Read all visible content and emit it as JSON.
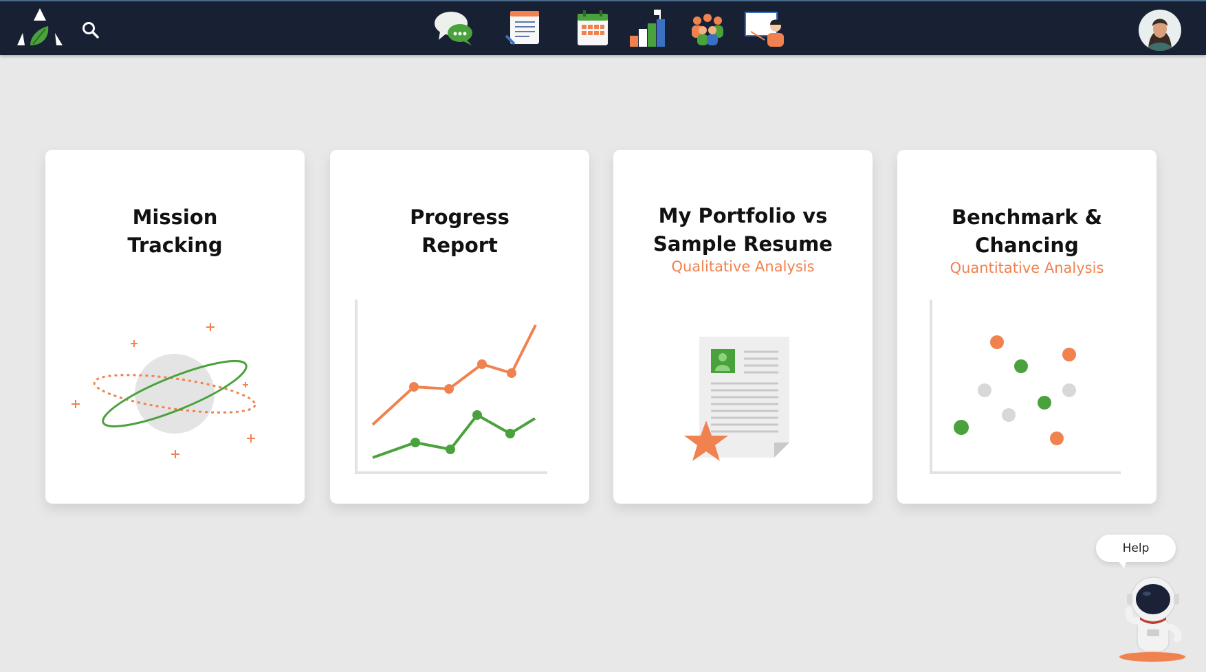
{
  "header": {
    "logo_icon": "leaf-triangle-logo-icon",
    "search_icon": "search-icon",
    "nav_icons": [
      "chat-bubbles-icon",
      "notepad-icon",
      "calendar-icon",
      "progress-flag-icon",
      "group-icon",
      "presentation-icon"
    ],
    "avatar_icon": "user-avatar"
  },
  "cards": [
    {
      "title_line1": "Mission",
      "title_line2": "Tracking",
      "subtitle": "",
      "art_icon": "planet-orbit-icon"
    },
    {
      "title_line1": "Progress",
      "title_line2": "Report",
      "subtitle": "",
      "art_icon": "line-chart-icon"
    },
    {
      "title_line1": "My Portfolio vs",
      "title_line2": "Sample Resume",
      "subtitle": "Qualitative Analysis",
      "art_icon": "resume-star-icon"
    },
    {
      "title_line1": "Benchmark &",
      "title_line2": "Chancing",
      "subtitle": "Quantitative Analysis",
      "art_icon": "scatter-plot-icon"
    }
  ],
  "help": {
    "label": "Help",
    "icon": "astronaut-icon"
  },
  "colors": {
    "header_bg": "#182133",
    "accent_orange": "#f0824f",
    "accent_green": "#4aa23c",
    "page_bg": "#e8e8e8"
  }
}
